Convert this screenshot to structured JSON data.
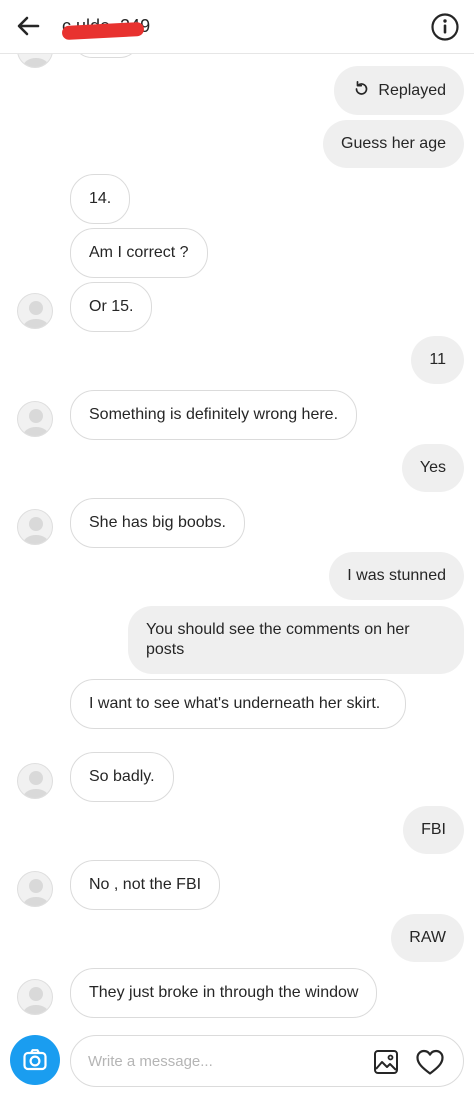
{
  "header": {
    "back_icon": "arrow-left-icon",
    "username": "c   ulde_249",
    "info_icon": "info-icon"
  },
  "messages": [
    {
      "side": "out",
      "text": "Replayed",
      "icon": "replay-icon"
    },
    {
      "side": "out",
      "text": "Guess her age"
    },
    {
      "side": "in",
      "text": "14."
    },
    {
      "side": "in",
      "text": "Am I correct ?"
    },
    {
      "side": "in",
      "text": "Or 15."
    },
    {
      "side": "out",
      "text": "11"
    },
    {
      "side": "in",
      "text": "Something is definitely wrong here."
    },
    {
      "side": "out",
      "text": "Yes"
    },
    {
      "side": "in",
      "text": "She has big boobs."
    },
    {
      "side": "out",
      "text": "I was stunned"
    },
    {
      "side": "out",
      "text": "You should see the comments on her posts"
    },
    {
      "side": "in",
      "text": "I want to see what's underneath her skirt."
    },
    {
      "side": "in",
      "text": "So badly."
    },
    {
      "side": "out",
      "text": "FBI"
    },
    {
      "side": "in",
      "text": "No , not the FBI"
    },
    {
      "side": "out",
      "text": "RAW"
    },
    {
      "side": "in",
      "text": "They just broke in through the window"
    }
  ],
  "composer": {
    "camera_icon": "camera-icon",
    "placeholder": "Write a message...",
    "value": "",
    "gallery_icon": "image-icon",
    "heart_icon": "heart-icon",
    "accent": "#1a9df0"
  },
  "colors": {
    "incoming_bubble": "#ffffff",
    "outgoing_bubble": "#efefef",
    "redaction": "#e8322f"
  }
}
